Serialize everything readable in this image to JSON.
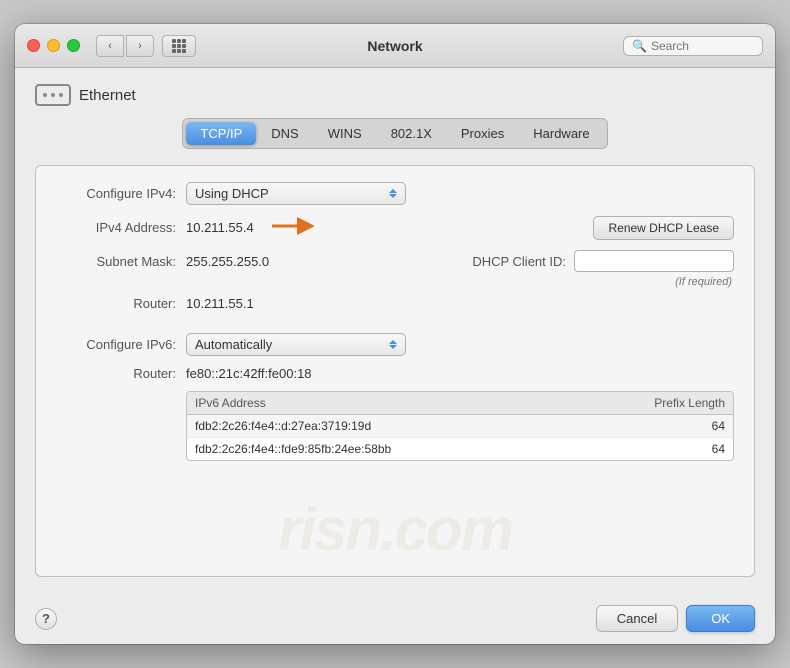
{
  "titlebar": {
    "title": "Network",
    "search_placeholder": "Search"
  },
  "ethernet": {
    "label": "Ethernet"
  },
  "tabs": [
    {
      "label": "TCP/IP",
      "active": true
    },
    {
      "label": "DNS",
      "active": false
    },
    {
      "label": "WINS",
      "active": false
    },
    {
      "label": "802.1X",
      "active": false
    },
    {
      "label": "Proxies",
      "active": false
    },
    {
      "label": "Hardware",
      "active": false
    }
  ],
  "form": {
    "configure_ipv4_label": "Configure IPv4:",
    "configure_ipv4_value": "Using DHCP",
    "ipv4_address_label": "IPv4 Address:",
    "ipv4_address_value": "10.211.55.4",
    "subnet_mask_label": "Subnet Mask:",
    "subnet_mask_value": "255.255.255.0",
    "router_ipv4_label": "Router:",
    "router_ipv4_value": "10.211.55.1",
    "renew_dhcp_label": "Renew DHCP Lease",
    "dhcp_client_id_label": "DHCP Client ID:",
    "dhcp_client_id_placeholder": "",
    "if_required_label": "(If required)",
    "configure_ipv6_label": "Configure IPv6:",
    "configure_ipv6_value": "Automatically",
    "router_ipv6_label": "Router:",
    "router_ipv6_value": "fe80::21c:42ff:fe00:18"
  },
  "ipv6_table": {
    "col_address": "IPv6 Address",
    "col_prefix": "Prefix Length",
    "rows": [
      {
        "address": "fdb2:2c26:f4e4::d:27ea:3719:19d",
        "prefix": "64"
      },
      {
        "address": "fdb2:2c26:f4e4::fde9:85fb:24ee:58bb",
        "prefix": "64"
      }
    ]
  },
  "bottom": {
    "help_label": "?",
    "cancel_label": "Cancel",
    "ok_label": "OK"
  }
}
